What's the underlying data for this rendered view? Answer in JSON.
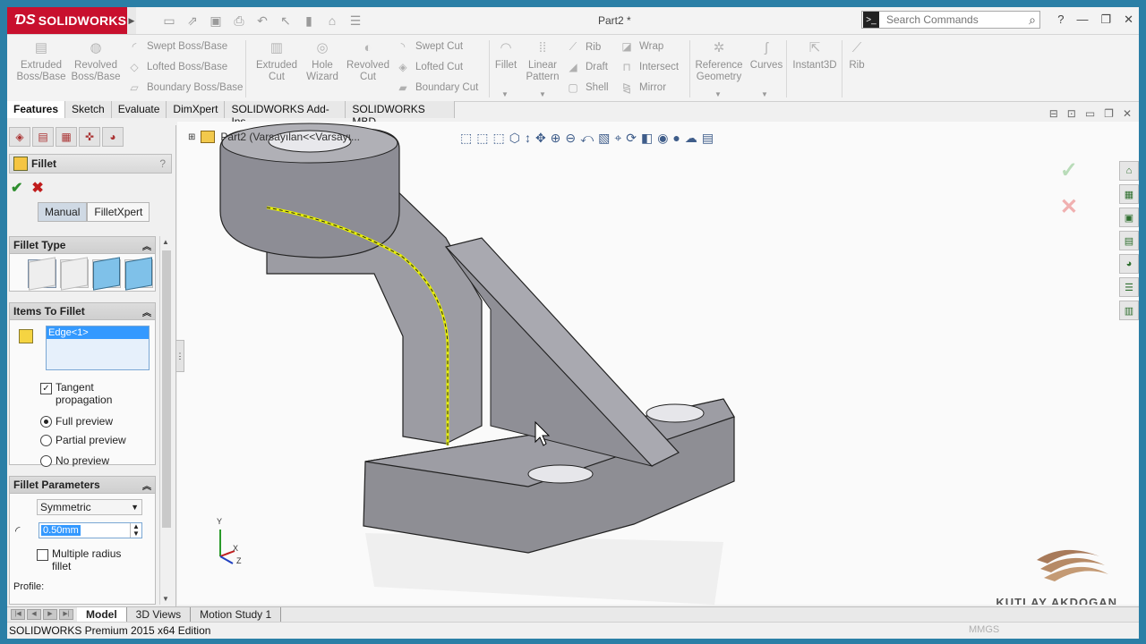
{
  "app": {
    "brand": "SOLIDWORKS",
    "document_title": "Part2 *",
    "search_placeholder": "Search Commands"
  },
  "ribbon": {
    "extruded_boss": "Extruded Boss/Base",
    "revolved_boss": "Revolved Boss/Base",
    "swept_boss": "Swept Boss/Base",
    "lofted_boss": "Lofted Boss/Base",
    "boundary_boss": "Boundary Boss/Base",
    "extruded_cut": "Extruded Cut",
    "hole_wizard": "Hole Wizard",
    "revolved_cut": "Revolved Cut",
    "swept_cut": "Swept Cut",
    "lofted_cut": "Lofted Cut",
    "boundary_cut": "Boundary Cut",
    "fillet": "Fillet",
    "linear_pattern": "Linear Pattern",
    "rib": "Rib",
    "draft": "Draft",
    "shell": "Shell",
    "wrap": "Wrap",
    "intersect": "Intersect",
    "mirror": "Mirror",
    "reference_geometry": "Reference Geometry",
    "curves": "Curves",
    "instant3d": "Instant3D",
    "rib2": "Rib"
  },
  "tabs": [
    "Features",
    "Sketch",
    "Evaluate",
    "DimXpert",
    "SOLIDWORKS Add-Ins",
    "SOLIDWORKS MBD"
  ],
  "property_manager": {
    "title": "Fillet",
    "help": "?",
    "mode_manual": "Manual",
    "mode_filletxpert": "FilletXpert",
    "fillet_type_header": "Fillet Type",
    "items_header": "Items To Fillet",
    "selected_item": "Edge<1>",
    "tangent_propagation": "Tangent propagation",
    "full_preview": "Full preview",
    "partial_preview": "Partial preview",
    "no_preview": "No preview",
    "params_header": "Fillet Parameters",
    "symmetric": "Symmetric",
    "radius": "0.50mm",
    "multiple_radius": "Multiple radius fillet",
    "profile": "Profile:"
  },
  "viewport": {
    "tree_label": "Part2  (Varsayılan<<Varsayı...",
    "triad_y": "Y",
    "triad_x": "X",
    "triad_z": "Z",
    "watermark": "KUTLAY AKDOGAN"
  },
  "bottom_tabs": [
    "Model",
    "3D Views",
    "Motion Study 1"
  ],
  "status": {
    "edition": "SOLIDWORKS Premium 2015 x64 Edition",
    "units": "MMGS"
  },
  "colors": {
    "brand_red": "#c8102e",
    "selection_blue": "#3399ff",
    "edge_highlight": "#e8f000",
    "part_gray": "#8e8e94"
  }
}
